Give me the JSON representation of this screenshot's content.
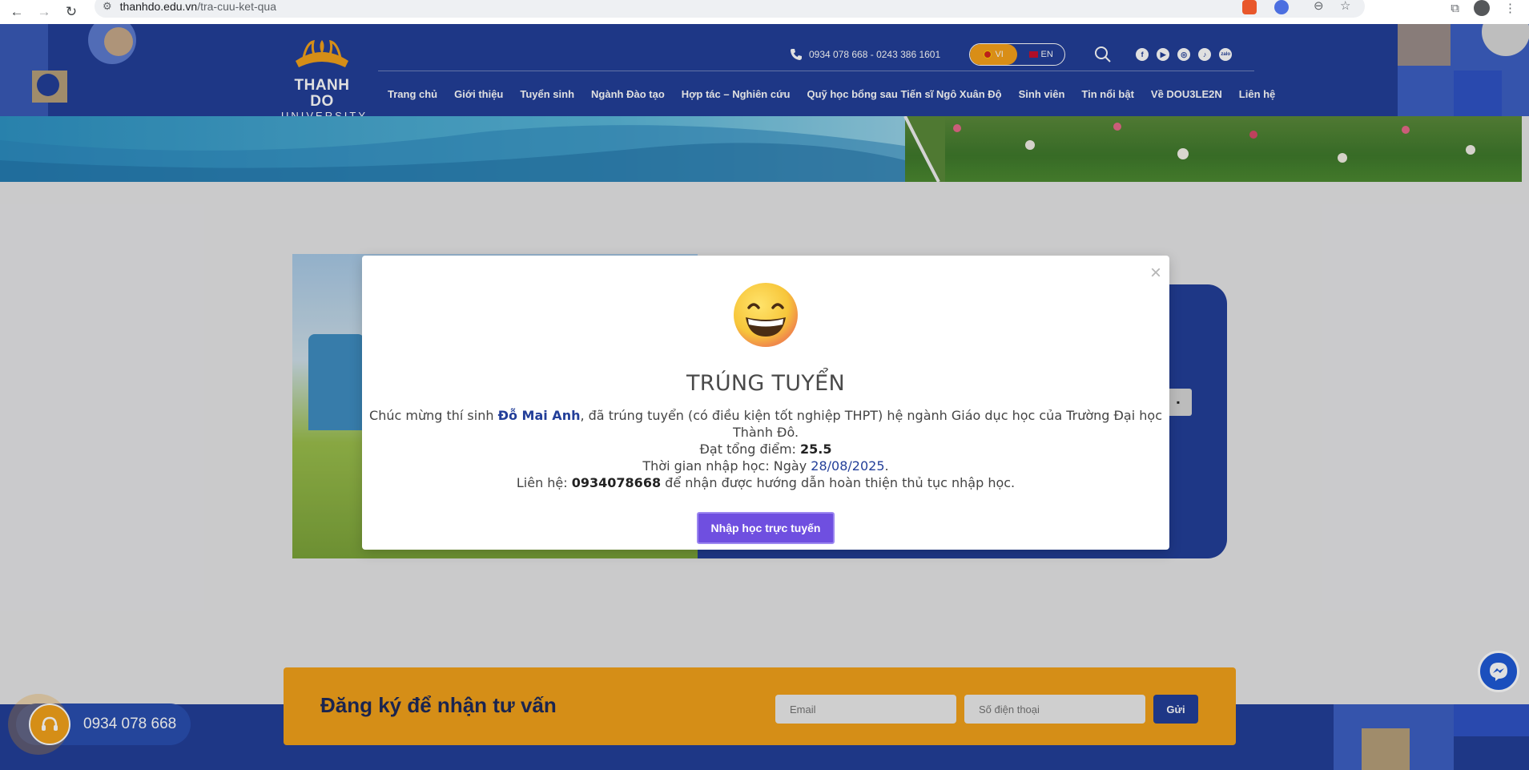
{
  "browser": {
    "url_host": "thanhdo.edu.vn",
    "url_path": "/tra-cuu-ket-qua"
  },
  "header": {
    "logo_name": "THANH DO",
    "logo_sub": "UNIVERSITY",
    "phone": "0934 078 668 - 0243 386 1601",
    "lang_vi": "VI",
    "lang_en": "EN",
    "socials": [
      "f",
      "▶",
      "◎",
      "♪",
      "zalo"
    ],
    "nav": [
      "Trang chủ",
      "Giới thiệu",
      "Tuyển sinh",
      "Ngành Đào tạo",
      "Hợp tác – Nghiên cứu",
      "Quỹ học bổng sau Tiến sĩ Ngô Xuân Độ",
      "Sinh viên",
      "Tin nổi bật",
      "Về DOU3LE2N",
      "Liên hệ"
    ]
  },
  "modal": {
    "close": "×",
    "title": "TRÚNG TUYỂN",
    "line1_prefix": "Chúc mừng thí sinh ",
    "student_name": "Đỗ Mai Anh",
    "line1_suffix": ", đã trúng tuyển (có điều kiện tốt nghiệp THPT) hệ ngành Giáo dục học của Trường Đại học Thành Đô.",
    "score_label": "Đạt tổng điểm: ",
    "score": "25.5",
    "date_label": "Thời gian nhập học: Ngày ",
    "date": "28/08/2025",
    "date_end": ".",
    "contact_label": "Liên hệ: ",
    "contact_phone": "0934078668",
    "contact_suffix": " để nhận được hướng dẫn hoàn thiện thủ tục nhập học.",
    "button": "Nhập học trực tuyến"
  },
  "consult": {
    "title": "Đăng ký để nhận tư vấn",
    "email_placeholder": "Email",
    "phone_placeholder": "Số điện thoại",
    "send": "Gửi"
  },
  "hotline": {
    "number": "0934 078 668"
  },
  "colors": {
    "brand_blue": "#233f99",
    "accent_orange": "#f3a21b",
    "button_purple": "#6f4fe0"
  }
}
